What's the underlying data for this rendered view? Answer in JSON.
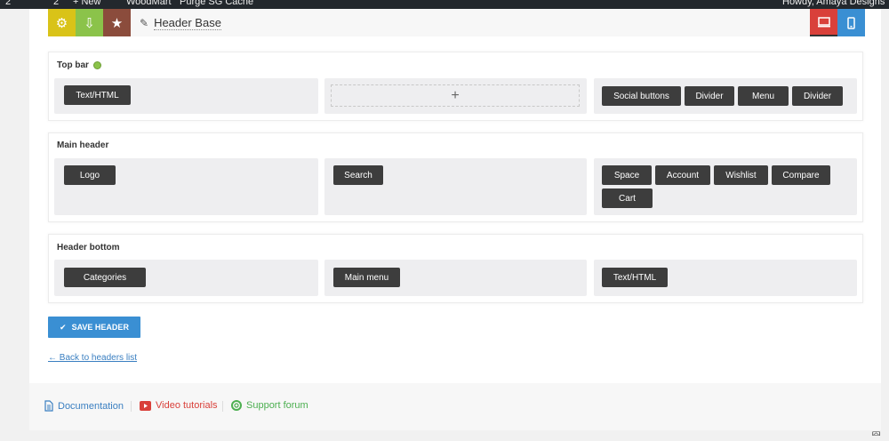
{
  "admin_bar": {
    "updates": "2",
    "comments": "2",
    "new": "+ New",
    "woodmart": "WoodMart",
    "purge": "Purge SG Cache",
    "howdy": "Howdy, Amaya Designs"
  },
  "toolbar": {
    "icons": [
      "gear-icon",
      "download-icon",
      "star-icon"
    ],
    "colors": {
      "gear": "#d9c318",
      "download": "#8bc34a",
      "star": "#8b4c3c",
      "desktop": "#d9403a",
      "mobile": "#3a8fd3"
    },
    "title": "Header Base"
  },
  "sections": {
    "top_bar": {
      "title": "Top bar",
      "left": [
        "Text/HTML"
      ],
      "center_add": "+",
      "right": [
        "Social buttons",
        "Divider",
        "Menu",
        "Divider"
      ]
    },
    "main_header": {
      "title": "Main header",
      "left": [
        "Logo"
      ],
      "center": [
        "Search"
      ],
      "right": [
        "Space",
        "Account",
        "Wishlist",
        "Compare",
        "Cart"
      ]
    },
    "header_bottom": {
      "title": "Header bottom",
      "left": [
        "Categories"
      ],
      "center": [
        "Main menu"
      ],
      "right": [
        "Text/HTML"
      ]
    }
  },
  "actions": {
    "save_label": "SAVE HEADER",
    "back_label": "← Back to headers list"
  },
  "footer": {
    "documentation": "Documentation",
    "video": "Video tutorials",
    "support": "Support forum",
    "colors": {
      "documentation": "#3a7fc1",
      "video": "#d9403a",
      "support": "#4caf50"
    }
  }
}
